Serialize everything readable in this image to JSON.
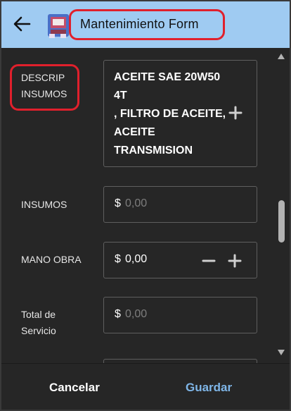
{
  "header": {
    "title": "Mantenimiento Form",
    "back_icon": "arrow-left-icon",
    "logo_icon": "app-logo-icon",
    "background": "#9fcbf2"
  },
  "form": {
    "descrip_insumos": {
      "label_line1": "DESCRIP",
      "label_line2": "INSUMOS",
      "value_lines": [
        "ACEITE SAE 20W50",
        "4T",
        ", FILTRO DE ACEITE,",
        "ACEITE",
        "TRANSMISION"
      ],
      "add_icon": "plus-icon"
    },
    "insumos": {
      "label": "INSUMOS",
      "prefix": "$",
      "placeholder": "0,00"
    },
    "mano_obra": {
      "label": "MANO OBRA",
      "prefix": "$",
      "value": "0,00",
      "minus_icon": "minus-icon",
      "plus_icon": "plus-icon"
    },
    "total_servicio": {
      "label_line1": "Total de",
      "label_line2": "Servicio",
      "prefix": "$",
      "placeholder": "0,00"
    }
  },
  "footer": {
    "cancel_label": "Cancelar",
    "save_label": "Guardar"
  },
  "colors": {
    "content_bg": "#262626",
    "accent_blue": "#7fb6e8",
    "highlight_red": "#e0202c",
    "placeholder": "#7d7d7d"
  }
}
